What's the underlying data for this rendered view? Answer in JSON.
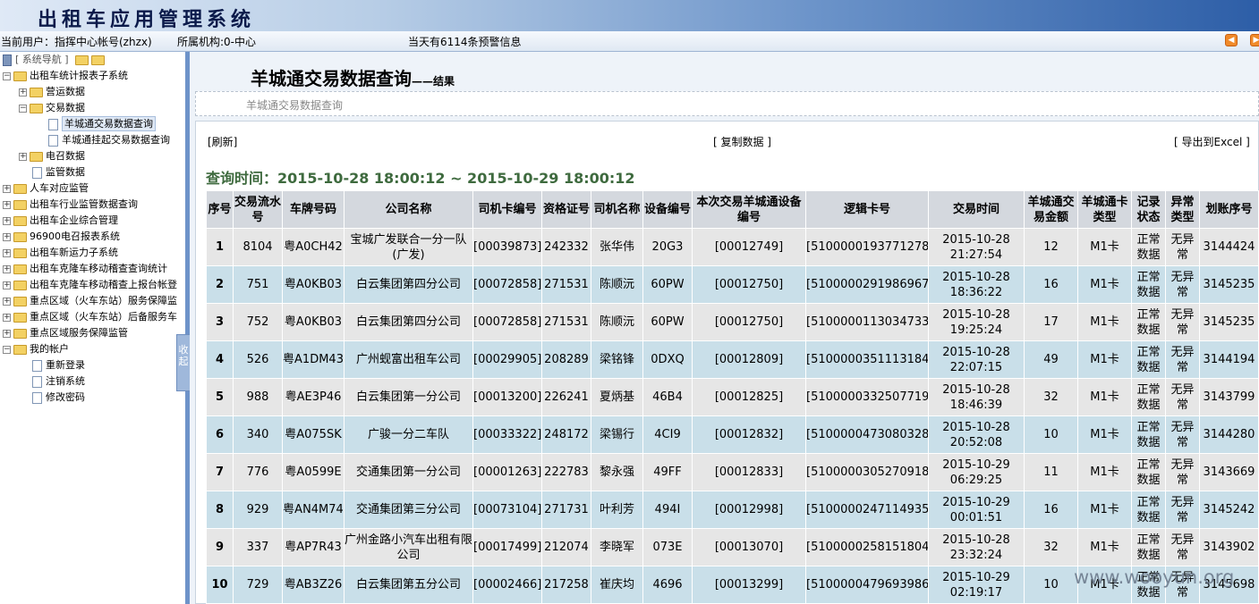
{
  "app": {
    "title": "出租车应用管理系统"
  },
  "infobar": {
    "user": "当前用户：指挥中心帐号(zhzx)",
    "org": "所属机构:0-中心",
    "warn": "当天有6114条预警信息",
    "prev_icon": "arrow-left-icon",
    "next_icon": "arrow-right-icon"
  },
  "sidebar": {
    "nav": "[ 系统导航 ]",
    "items": [
      {
        "label": "出租车统计报表子系统"
      },
      {
        "label": "营运数据"
      },
      {
        "label": "交易数据"
      },
      {
        "label": "羊城通交易数据查询"
      },
      {
        "label": "羊城通挂起交易数据查询"
      },
      {
        "label": "电召数据"
      },
      {
        "label": "监管数据"
      },
      {
        "label": "人车对应监管"
      },
      {
        "label": "出租车行业监管数据查询"
      },
      {
        "label": "出租车企业综合管理"
      },
      {
        "label": "96900电召报表系统"
      },
      {
        "label": "出租车新运力子系统"
      },
      {
        "label": "出租车克隆车移动稽查查询统计"
      },
      {
        "label": "出租车克隆车移动稽查上报台帐登"
      },
      {
        "label": "重点区域（火车东站）服务保障监"
      },
      {
        "label": "重点区域（火车东站）后备服务车"
      },
      {
        "label": "重点区域服务保障监管"
      },
      {
        "label": "我的帐户"
      },
      {
        "label": "重新登录"
      },
      {
        "label": "注销系统"
      },
      {
        "label": "修改密码"
      }
    ],
    "collapse": "收起"
  },
  "main": {
    "title": "羊城通交易数据查询",
    "title_suffix": "——结果",
    "breadcrumb": "羊城通交易数据查询",
    "refresh": "[刷新]",
    "copy": "[ 复制数据 ]",
    "export": "[ 导出到Excel ]",
    "query_time": "查询时间：2015-10-28 18:00:12 ~ 2015-10-29 18:00:12"
  },
  "table": {
    "headers": [
      "序号",
      "交易流水号",
      "车牌号码",
      "公司名称",
      "司机卡编号",
      "资格证号",
      "司机名称",
      "设备编号",
      "本次交易羊城通设备编号",
      "逻辑卡号",
      "交易时间",
      "羊城通交易金额",
      "羊城通卡类型",
      "记录状态",
      "异常类型",
      "划账序号"
    ],
    "rows": [
      [
        "1",
        "8104",
        "粤A0CH42",
        "宝城广发联合一分一队(广发)",
        "[00039873]",
        "242332",
        "张华伟",
        "20G3",
        "[00012749]",
        "[5100000193771278]",
        "2015-10-28 21:27:54",
        "12",
        "M1卡",
        "正常数据",
        "无异常",
        "3144424"
      ],
      [
        "2",
        "751",
        "粤A0KB03",
        "白云集团第四分公司",
        "[00072858]",
        "271531",
        "陈顺沅",
        "60PW",
        "[00012750]",
        "[5100000291986967]",
        "2015-10-28 18:36:22",
        "16",
        "M1卡",
        "正常数据",
        "无异常",
        "3145235"
      ],
      [
        "3",
        "752",
        "粤A0KB03",
        "白云集团第四分公司",
        "[00072858]",
        "271531",
        "陈顺沅",
        "60PW",
        "[00012750]",
        "[5100000113034733]",
        "2015-10-28 19:25:24",
        "17",
        "M1卡",
        "正常数据",
        "无异常",
        "3145235"
      ],
      [
        "4",
        "526",
        "粤A1DM43",
        "广州蚬富出租车公司",
        "[00029905]",
        "208289",
        "梁铭锋",
        "0DXQ",
        "[00012809]",
        "[5100000351113184]",
        "2015-10-28 22:07:15",
        "49",
        "M1卡",
        "正常数据",
        "无异常",
        "3144194"
      ],
      [
        "5",
        "988",
        "粤AE3P46",
        "白云集团第一分公司",
        "[00013200]",
        "226241",
        "夏炳基",
        "46B4",
        "[00012825]",
        "[5100000332507719]",
        "2015-10-28 18:46:39",
        "32",
        "M1卡",
        "正常数据",
        "无异常",
        "3143799"
      ],
      [
        "6",
        "340",
        "粤A075SK",
        "广骏一分二车队",
        "[00033322]",
        "248172",
        "梁锡行",
        "4CI9",
        "[00012832]",
        "[5100000473080328]",
        "2015-10-28 20:52:08",
        "10",
        "M1卡",
        "正常数据",
        "无异常",
        "3144280"
      ],
      [
        "7",
        "776",
        "粤A0599E",
        "交通集团第一分公司",
        "[00001263]",
        "222783",
        "黎永强",
        "49FF",
        "[00012833]",
        "[5100000305270918]",
        "2015-10-29 06:29:25",
        "11",
        "M1卡",
        "正常数据",
        "无异常",
        "3143669"
      ],
      [
        "8",
        "929",
        "粤AN4M74",
        "交通集团第三分公司",
        "[00073104]",
        "271731",
        "叶利芳",
        "494I",
        "[00012998]",
        "[5100000247114935]",
        "2015-10-29 00:01:51",
        "16",
        "M1卡",
        "正常数据",
        "无异常",
        "3145242"
      ],
      [
        "9",
        "337",
        "粤AP7R43",
        "广州金路小汽车出租有限公司",
        "[00017499]",
        "212074",
        "李晓军",
        "073E",
        "[00013070]",
        "[5100000258151804]",
        "2015-10-28 23:32:24",
        "32",
        "M1卡",
        "正常数据",
        "无异常",
        "3143902"
      ],
      [
        "10",
        "729",
        "粤AB3Z26",
        "白云集团第五分公司",
        "[00002466]",
        "217258",
        "崔庆均",
        "4696",
        "[00013299]",
        "[5100000479693986]",
        "2015-10-29 02:19:17",
        "10",
        "M1卡",
        "正常数据",
        "无异常",
        "3145698"
      ]
    ]
  },
  "watermark": "www.wooyun.org"
}
